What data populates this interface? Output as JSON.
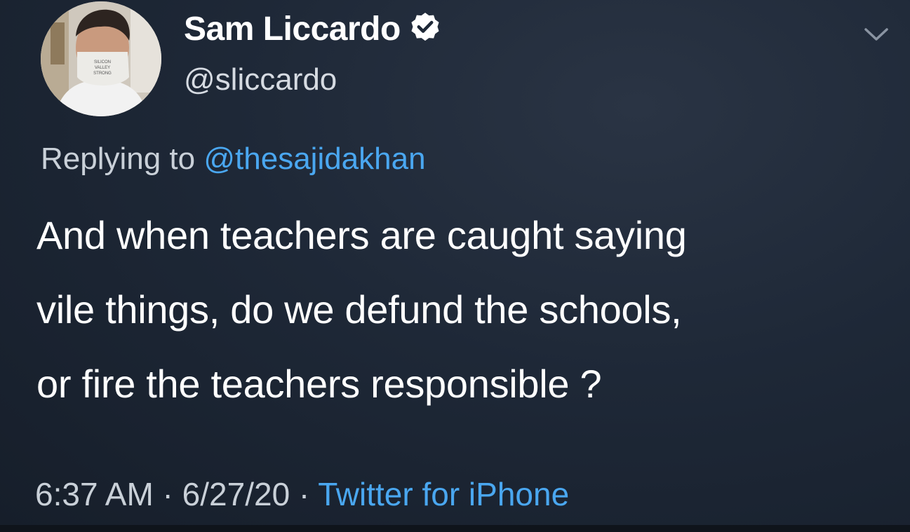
{
  "author": {
    "display_name": "Sam Liccardo",
    "handle": "@sliccardo",
    "verified": true
  },
  "reply": {
    "prefix": "Replying to ",
    "mention": "@thesajidakhan"
  },
  "tweet": {
    "lines": [
      "And when teachers are caught saying",
      "vile things, do we defund the schools,",
      "or fire the teachers responsible ?"
    ]
  },
  "meta": {
    "time": "6:37 AM",
    "separator": " · ",
    "date": "6/27/20",
    "source": "Twitter for iPhone"
  },
  "icons": {
    "verified": "verified-badge-icon",
    "menu": "chevron-down-icon"
  },
  "colors": {
    "background": "#1e2837",
    "link": "#4aa7f0",
    "text": "#ffffff",
    "muted": "#c9d0d8"
  }
}
